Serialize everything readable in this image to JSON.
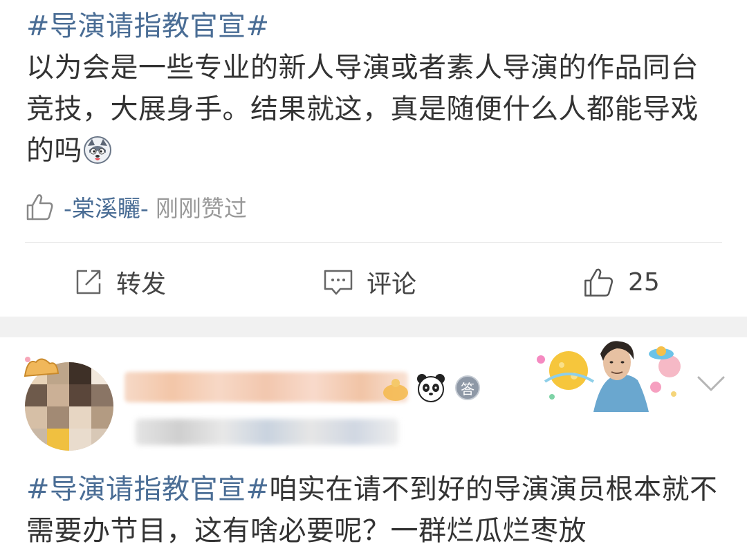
{
  "post1": {
    "hashtag": "#导演请指教官宣#",
    "body": "以为会是一些专业的新人导演或者素人导演的作品同台竞技，大展身手。结果就这，真是随便什么人都能导戏的吗",
    "liked_by": "-棠溪矖-",
    "liked_suffix": "刚刚赞过",
    "actions": {
      "repost_label": "转发",
      "comment_label": "评论",
      "like_count": "25"
    }
  },
  "post2": {
    "badge_text": "答",
    "hashtag": "#导演请指教官宣#",
    "body": "咱实在请不到好的导演演员根本就不需要办节目，这有啥必要呢？一群烂瓜烂枣放"
  },
  "colors": {
    "link": "#4a6d95",
    "text": "#333333",
    "muted": "#999999",
    "divider_gap": "#f1f1f1"
  },
  "icons": {
    "like": "thumbs-up-icon",
    "repost": "share-icon",
    "comment": "comment-icon",
    "expand": "chevron-down-icon",
    "emoji": "husky-face-emoji-icon"
  }
}
